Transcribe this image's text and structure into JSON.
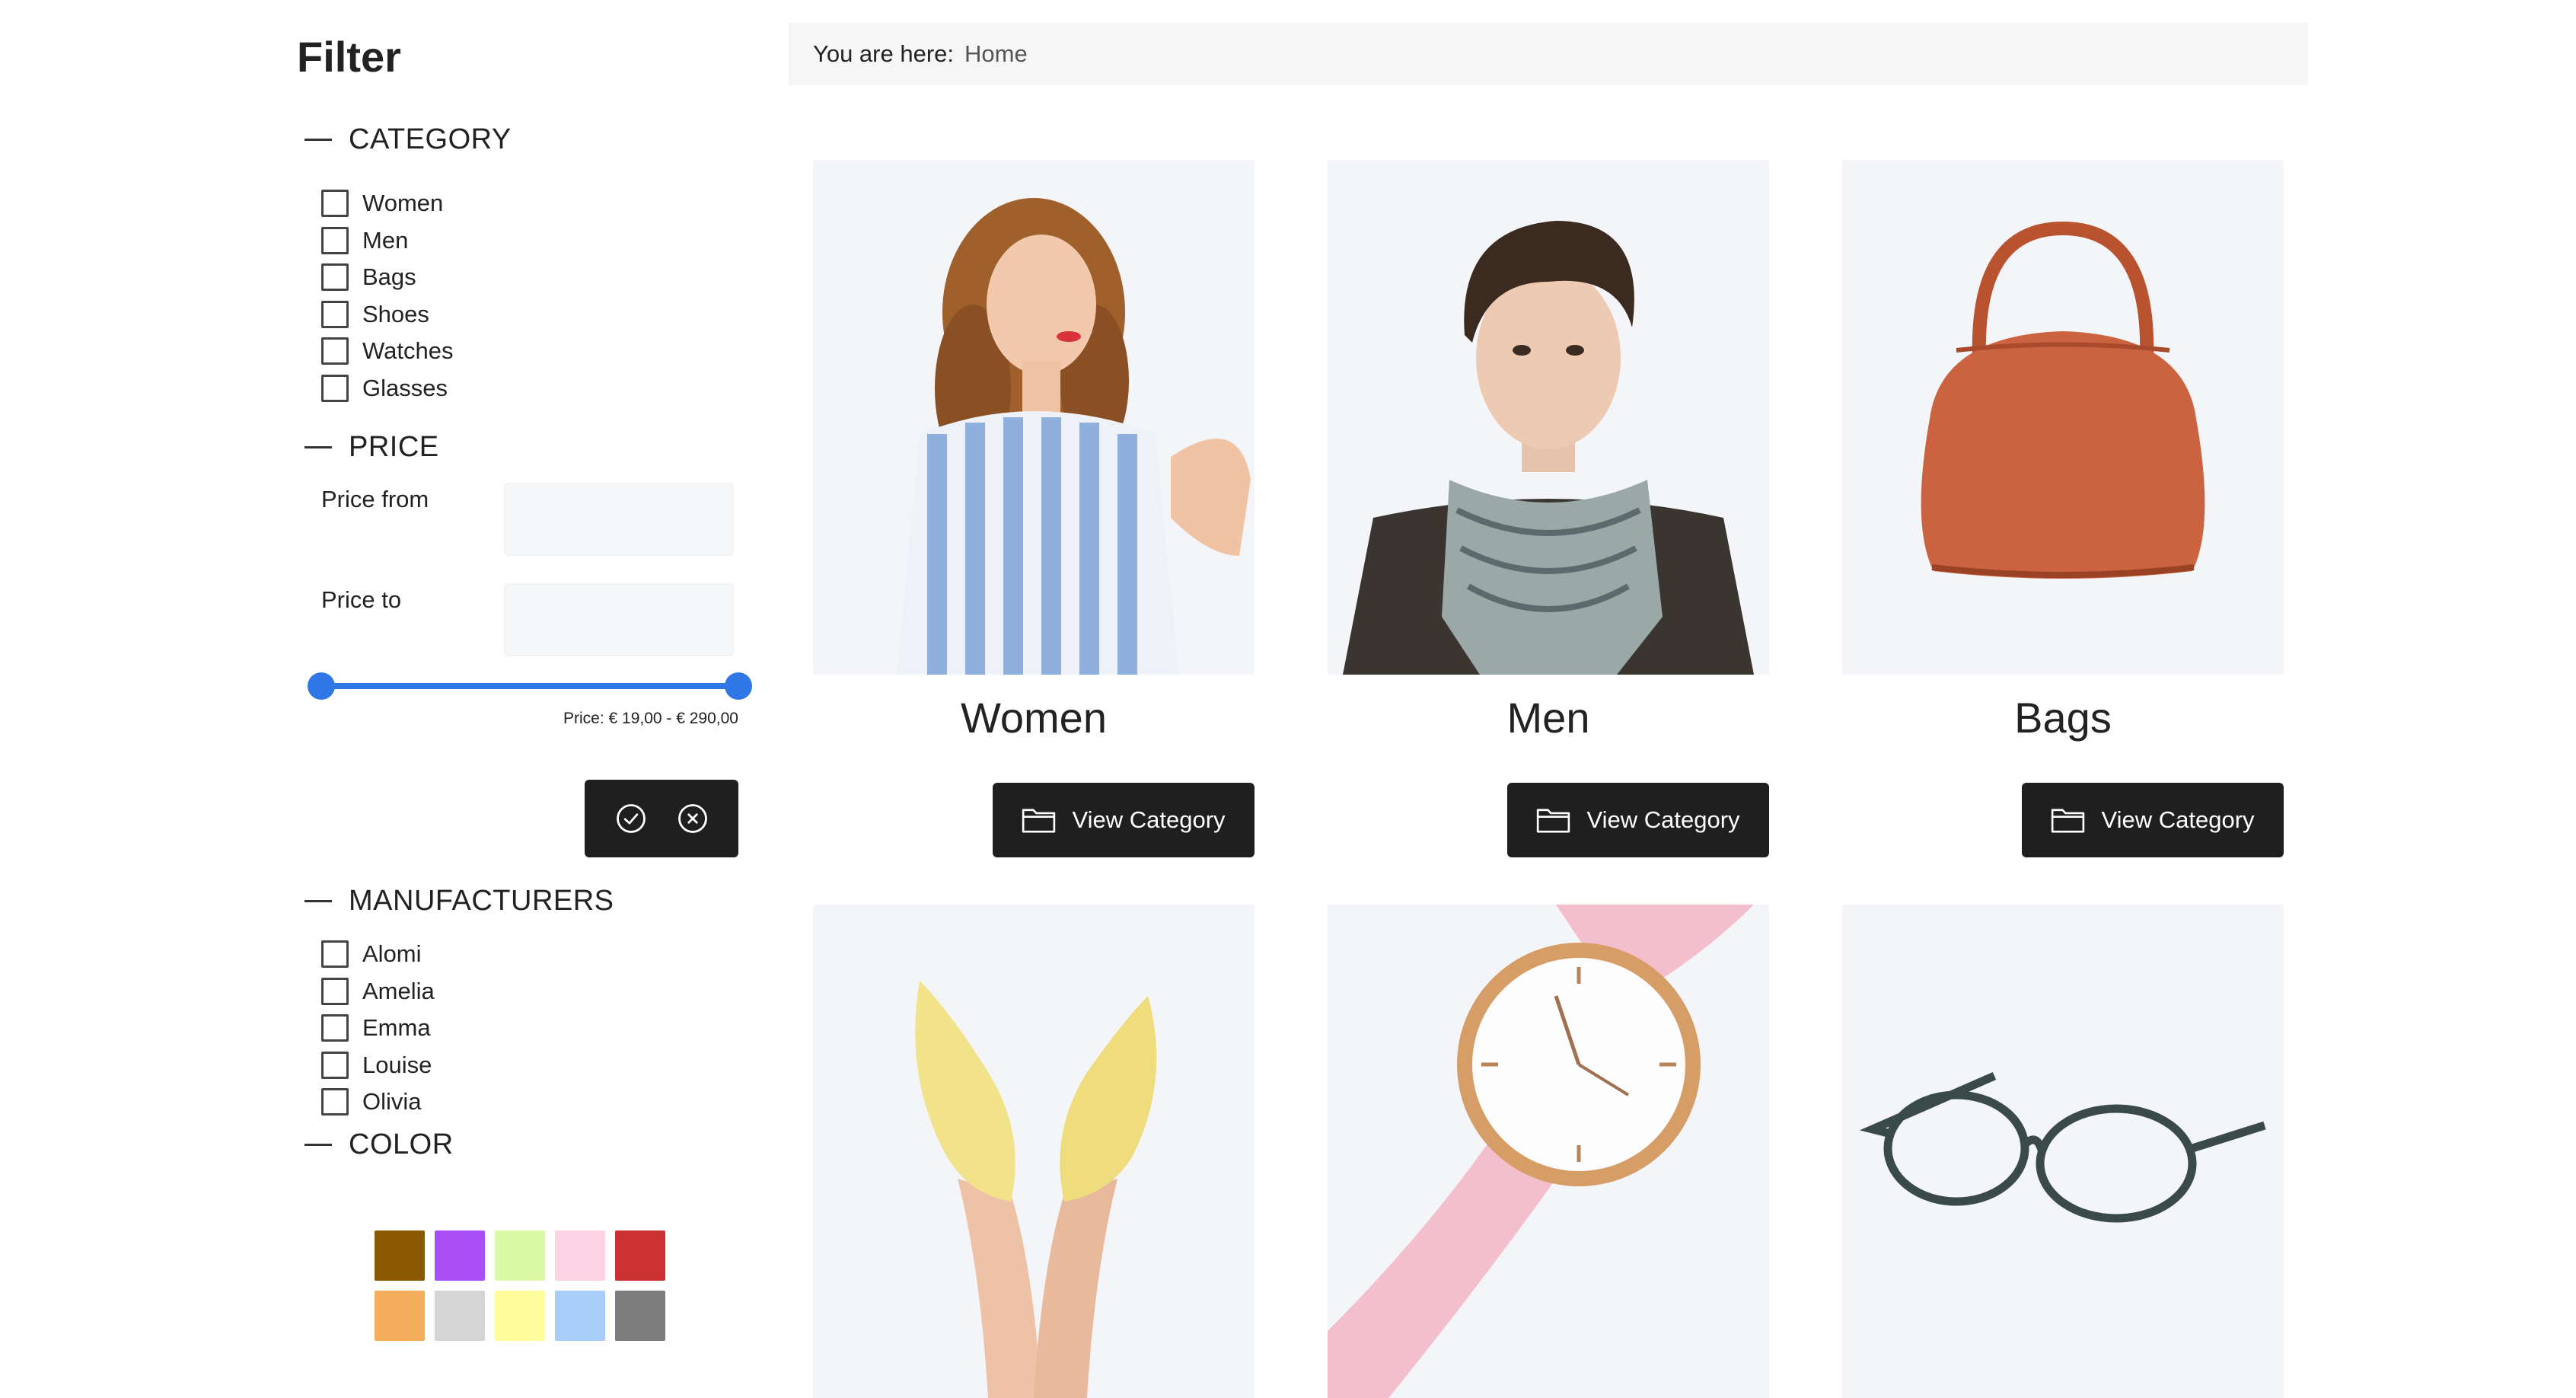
{
  "sidebar": {
    "title": "Filter",
    "category": {
      "heading": "CATEGORY",
      "items": [
        "Women",
        "Men",
        "Bags",
        "Shoes",
        "Watches",
        "Glasses"
      ]
    },
    "price": {
      "heading": "PRICE",
      "from_label": "Price from",
      "to_label": "Price to",
      "from_value": "",
      "to_value": "",
      "range_text": "Price: € 19,00 - € 290,00",
      "slider_min_fraction": 0,
      "slider_max_fraction": 1,
      "apply_icon": "check-circle-icon",
      "clear_icon": "x-circle-icon"
    },
    "manufacturers": {
      "heading": "MANUFACTURERS",
      "items": [
        "Alomi",
        "Amelia",
        "Emma",
        "Louise",
        "Olivia"
      ]
    },
    "color": {
      "heading": "COLOR",
      "swatches": [
        "#8b5a00",
        "#a84ff5",
        "#dcf9a6",
        "#fdd3e3",
        "#cc3131",
        "#f4ad5b",
        "#d5d5d5",
        "#fdfd9c",
        "#a8cdf8",
        "#7c7c7c"
      ]
    }
  },
  "breadcrumb": {
    "label": "You are here:",
    "current": "Home"
  },
  "categories": [
    {
      "name": "Women",
      "button": "View Category",
      "image": "woman-in-striped-dress"
    },
    {
      "name": "Men",
      "button": "View Category",
      "image": "man-with-scarf"
    },
    {
      "name": "Bags",
      "button": "View Category",
      "image": "orange-handbag"
    },
    {
      "name": "",
      "button": "",
      "image": "yellow-heeled-shoes"
    },
    {
      "name": "",
      "button": "",
      "image": "pink-strap-watch"
    },
    {
      "name": "",
      "button": "",
      "image": "glasses"
    }
  ]
}
